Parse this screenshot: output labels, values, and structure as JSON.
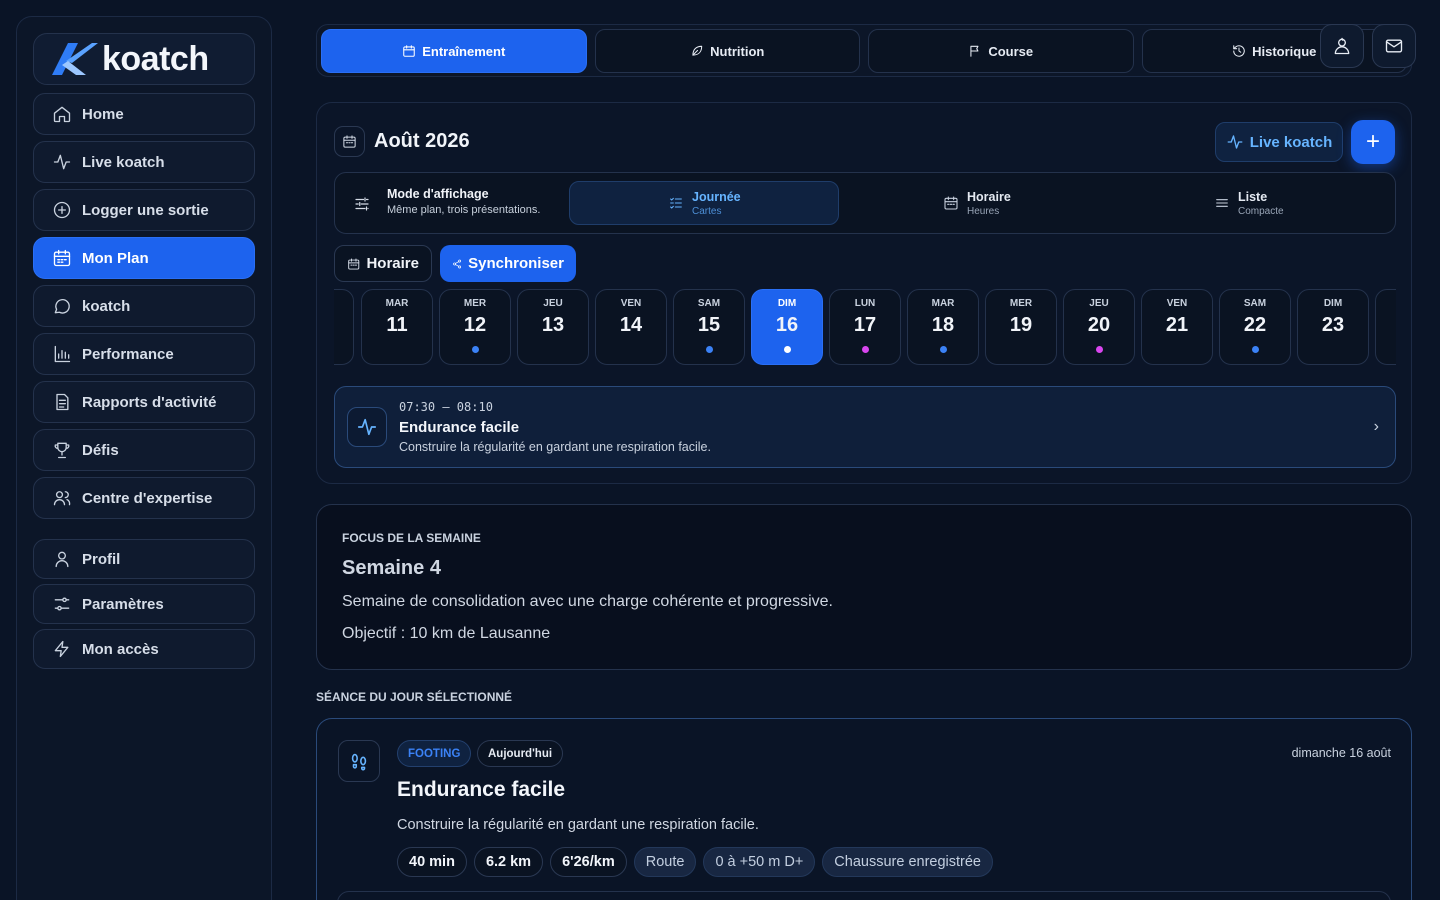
{
  "brand": {
    "name": "koatch",
    "accent": "#1d63ee"
  },
  "sidebar": {
    "items": [
      {
        "label": "Home",
        "icon": "home-icon"
      },
      {
        "label": "Live koatch",
        "icon": "activity-icon"
      },
      {
        "label": "Logger une sortie",
        "icon": "plus-circle-icon"
      },
      {
        "label": "Mon Plan",
        "icon": "calendar-icon",
        "active": true
      },
      {
        "label": "koatch",
        "icon": "chat-icon"
      },
      {
        "label": "Performance",
        "icon": "bar-chart-icon"
      },
      {
        "label": "Rapports d'activité",
        "icon": "document-icon"
      },
      {
        "label": "Défis",
        "icon": "trophy-icon"
      },
      {
        "label": "Centre d'expertise",
        "icon": "users-icon"
      }
    ],
    "secondary": [
      {
        "label": "Profil",
        "icon": "user-icon"
      },
      {
        "label": "Paramètres",
        "icon": "settings-icon"
      },
      {
        "label": "Mon accès",
        "icon": "bolt-icon"
      }
    ]
  },
  "tabs": [
    {
      "label": "Entraînement",
      "icon": "calendar-icon",
      "active": true
    },
    {
      "label": "Nutrition",
      "icon": "leaf-icon"
    },
    {
      "label": "Course",
      "icon": "flag-icon"
    },
    {
      "label": "Historique",
      "icon": "history-icon"
    }
  ],
  "plan": {
    "month": "Août 2026",
    "live_label": "Live koatch",
    "add_label": "+",
    "mode": {
      "title": "Mode d'affichage",
      "subtitle": "Même plan, trois présentations.",
      "options": [
        {
          "label": "Journée",
          "sub": "Cartes",
          "active": true
        },
        {
          "label": "Horaire",
          "sub": "Heures"
        },
        {
          "label": "Liste",
          "sub": "Compacte"
        }
      ]
    },
    "horaire_label": "Horaire",
    "sync_label": "Synchroniser",
    "days": [
      {
        "name": "MAR",
        "num": "11",
        "dot": ""
      },
      {
        "name": "MER",
        "num": "12",
        "dot": "#3b82f6"
      },
      {
        "name": "JEU",
        "num": "13",
        "dot": ""
      },
      {
        "name": "VEN",
        "num": "14",
        "dot": ""
      },
      {
        "name": "SAM",
        "num": "15",
        "dot": "#3b82f6"
      },
      {
        "name": "DIM",
        "num": "16",
        "dot": "#ffffff",
        "selected": true
      },
      {
        "name": "LUN",
        "num": "17",
        "dot": "#d946ef"
      },
      {
        "name": "MAR",
        "num": "18",
        "dot": "#3b82f6"
      },
      {
        "name": "MER",
        "num": "19",
        "dot": ""
      },
      {
        "name": "JEU",
        "num": "20",
        "dot": "#d946ef"
      },
      {
        "name": "VEN",
        "num": "21",
        "dot": ""
      },
      {
        "name": "SAM",
        "num": "22",
        "dot": "#3b82f6"
      },
      {
        "name": "DIM",
        "num": "23",
        "dot": ""
      }
    ],
    "session": {
      "time": "07:30 – 08:10",
      "title": "Endurance facile",
      "desc": "Construire la régularité en gardant une respiration facile."
    }
  },
  "focus": {
    "label": "FOCUS DE LA SEMAINE",
    "title": "Semaine 4",
    "desc": "Semaine de consolidation avec une charge cohérente et progressive.",
    "objective": "Objectif : 10 km de Lausanne"
  },
  "selected": {
    "section_label": "SÉANCE DU JOUR SÉLECTIONNÉ",
    "type_badge": "FOOTING",
    "day_badge": "Aujourd'hui",
    "date": "dimanche 16 août",
    "title": "Endurance facile",
    "desc": "Construire la régularité en gardant une respiration facile.",
    "chips": [
      "40 min",
      "6.2 km",
      "6'26/km",
      "Route",
      "0 à +50 m D+",
      "Chaussure enregistrée"
    ]
  }
}
